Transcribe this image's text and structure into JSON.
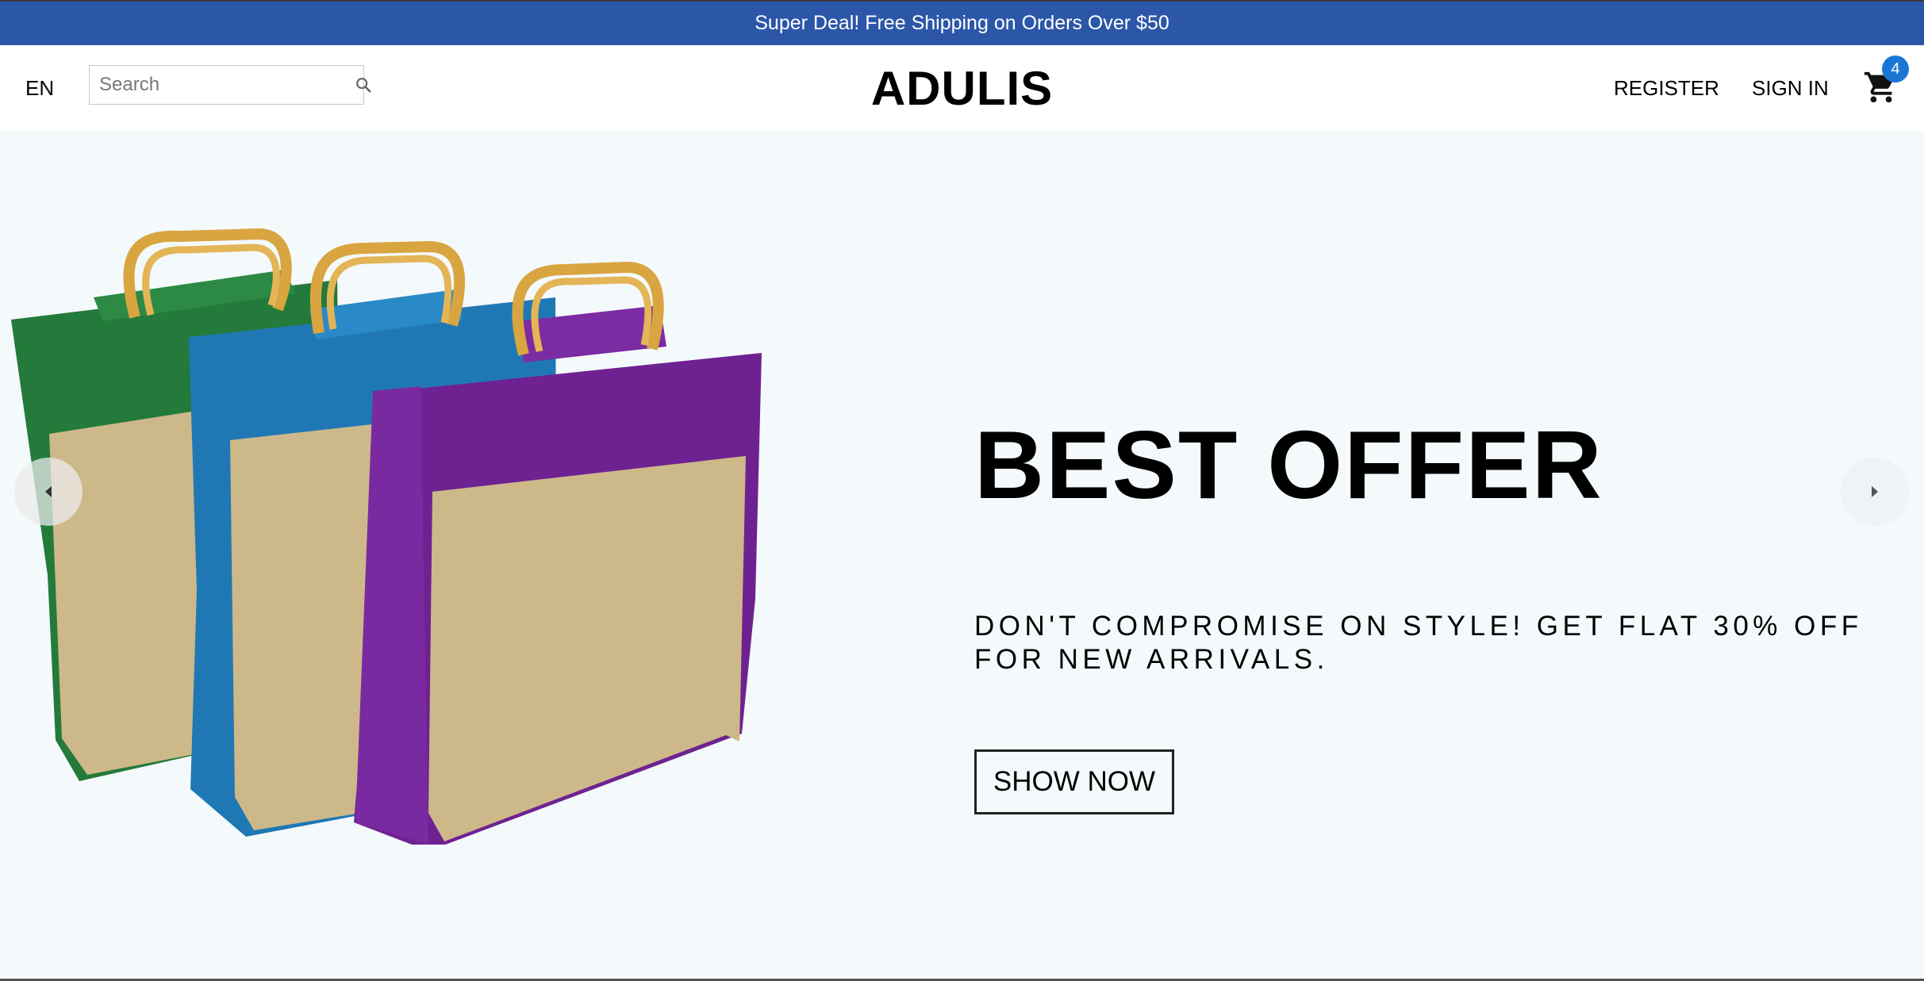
{
  "announcement": {
    "text": "Super Deal! Free Shipping on Orders Over $50"
  },
  "header": {
    "language": "EN",
    "search": {
      "placeholder": "Search",
      "value": "",
      "icon": "search-icon"
    },
    "logo": "ADULIS",
    "register_label": "REGISTER",
    "signin_label": "SIGN IN",
    "cart": {
      "icon": "shopping-cart-icon",
      "count": "4"
    }
  },
  "hero": {
    "title": "BEST OFFER",
    "description": "DON'T COMPROMISE ON STYLE! GET FLAT 30% OFF FOR NEW ARRIVALS.",
    "cta_label": "SHOW NOW",
    "image": "jute-tote-bags-green-blue-purple",
    "prev_icon": "arrow-left-icon",
    "next_icon": "arrow-right-icon"
  },
  "colors": {
    "announcement_bg": "#2c57a8",
    "hero_bg": "#f4f9fb",
    "badge_bg": "#1976d2",
    "bag_green": "#237a3a",
    "bag_blue": "#1f78b4",
    "bag_purple": "#6e2291",
    "jute": "#cdb88a",
    "handle": "#d9a540"
  }
}
